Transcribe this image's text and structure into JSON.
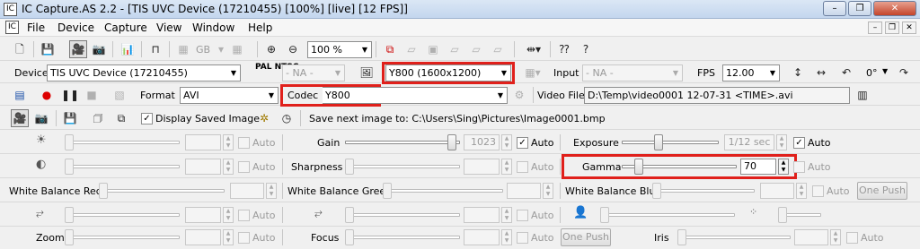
{
  "window": {
    "title": "IC Capture.AS 2.2 - [TIS UVC Device (17210455) [100%] [live]  [12 FPS]]",
    "app_icon": "IC"
  },
  "menu": [
    "File",
    "Device",
    "Capture",
    "View",
    "Window",
    "Help"
  ],
  "toolbar": {
    "zoom": "100 %",
    "gb_label": "GB"
  },
  "device_row": {
    "device_label": "Device",
    "device": "TIS UVC Device (17210455)",
    "pal_ntsc": "PAL NTSC",
    "vidnorm": "- NA -",
    "format": "Y800 (1600x1200)",
    "input_label": "Input",
    "input": "- NA -",
    "fps_label": "FPS",
    "fps": "12.00",
    "rotation": "0°"
  },
  "capture_row": {
    "format_label": "Format",
    "format": "AVI",
    "codec_label": "Codec",
    "codec": "Y800",
    "videofile_label": "Video File",
    "videofile": "D:\\Temp\\video0001 12-07-31 <TIME>.avi"
  },
  "image_row": {
    "display_saved_label": "Display Saved Image",
    "display_saved_checked": true,
    "save_next": "Save next image to: C:\\Users\\Sing\\Pictures\\Image0001.bmp"
  },
  "props": {
    "auto": "Auto",
    "one_push": "One Push",
    "gain": {
      "label": "Gain",
      "value": "1023",
      "auto": true
    },
    "exposure": {
      "label": "Exposure",
      "value": "1/12 sec",
      "auto": true
    },
    "sharpness": {
      "label": "Sharpness"
    },
    "gamma": {
      "label": "Gamma",
      "value": "70",
      "level": 0.12
    },
    "wb_red": {
      "label": "White Balance Red"
    },
    "wb_green": {
      "label": "White Balance Green"
    },
    "wb_blue": {
      "label": "White Balance Blue"
    },
    "zoom": {
      "label": "Zoom"
    },
    "focus": {
      "label": "Focus"
    },
    "iris": {
      "label": "Iris"
    }
  },
  "colors": {
    "highlight": "#e0201b",
    "title_bg": "#c3d6ee"
  }
}
